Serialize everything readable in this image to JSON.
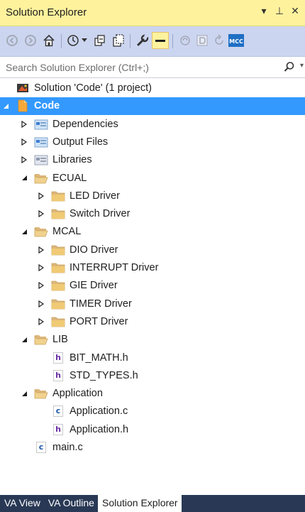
{
  "window": {
    "title": "Solution Explorer",
    "controls": [
      {
        "name": "dropdown-arrow-icon",
        "glyph": "▾"
      },
      {
        "name": "pin-icon",
        "glyph": "⊥"
      },
      {
        "name": "close-icon",
        "glyph": "✕"
      }
    ]
  },
  "toolbar": {
    "buttons": [
      "back-icon",
      "forward-icon",
      "home-icon",
      "pending-changes-icon",
      "collapse-all-icon",
      "show-all-files-icon",
      "properties-icon",
      "preview-selected-icon",
      "sync-icon",
      "view-code-icon",
      "refresh-icon",
      "mcc-icon"
    ],
    "mcc_label": "MCC"
  },
  "search": {
    "placeholder": "Search Solution Explorer (Ctrl+;)",
    "value": ""
  },
  "tree": [
    {
      "label": "Solution 'Code' (1 project)",
      "level": 0,
      "icon": "solution-icon",
      "expander": "none"
    },
    {
      "label": "Code",
      "level": 0,
      "icon": "project-icon",
      "expander": "expanded",
      "selected": true
    },
    {
      "label": "Dependencies",
      "level": 1,
      "icon": "dependencies-icon",
      "expander": "collapsed"
    },
    {
      "label": "Output Files",
      "level": 1,
      "icon": "output-files-icon",
      "expander": "collapsed"
    },
    {
      "label": "Libraries",
      "level": 1,
      "icon": "libraries-icon",
      "expander": "collapsed"
    },
    {
      "label": "ECUAL",
      "level": 1,
      "icon": "folder-open-icon",
      "expander": "expanded"
    },
    {
      "label": "LED Driver",
      "level": 2,
      "icon": "folder-icon",
      "expander": "collapsed"
    },
    {
      "label": "Switch Driver",
      "level": 2,
      "icon": "folder-icon",
      "expander": "collapsed"
    },
    {
      "label": "MCAL",
      "level": 1,
      "icon": "folder-open-icon",
      "expander": "expanded"
    },
    {
      "label": "DIO Driver",
      "level": 2,
      "icon": "folder-icon",
      "expander": "collapsed"
    },
    {
      "label": "INTERRUPT Driver",
      "level": 2,
      "icon": "folder-icon",
      "expander": "collapsed"
    },
    {
      "label": "GIE Driver",
      "level": 2,
      "icon": "folder-icon",
      "expander": "collapsed"
    },
    {
      "label": "TIMER Driver",
      "level": 2,
      "icon": "folder-icon",
      "expander": "collapsed"
    },
    {
      "label": "PORT Driver",
      "level": 2,
      "icon": "folder-icon",
      "expander": "collapsed"
    },
    {
      "label": "LIB",
      "level": 1,
      "icon": "folder-open-icon",
      "expander": "expanded"
    },
    {
      "label": "BIT_MATH.h",
      "level": 2,
      "icon": "header-file-icon",
      "expander": "none",
      "glyph": "h"
    },
    {
      "label": "STD_TYPES.h",
      "level": 2,
      "icon": "header-file-icon",
      "expander": "none",
      "glyph": "h"
    },
    {
      "label": "Application",
      "level": 1,
      "icon": "folder-open-icon",
      "expander": "expanded"
    },
    {
      "label": "Application.c",
      "level": 2,
      "icon": "c-file-icon",
      "expander": "none",
      "glyph": "c"
    },
    {
      "label": "Application.h",
      "level": 2,
      "icon": "header-file-icon",
      "expander": "none",
      "glyph": "h"
    },
    {
      "label": "main.c",
      "level": 1,
      "icon": "c-file-icon",
      "expander": "none",
      "glyph": "c"
    }
  ],
  "bottom_tabs": [
    {
      "label": "VA View",
      "active": false
    },
    {
      "label": "VA Outline",
      "active": false
    },
    {
      "label": "Solution Explorer",
      "active": true
    }
  ],
  "colors": {
    "title_bar": "#fff29d",
    "toolbar": "#ccd5f0",
    "selection": "#3399ff",
    "folder": "#dcb67a",
    "tab_strip": "#293955"
  }
}
